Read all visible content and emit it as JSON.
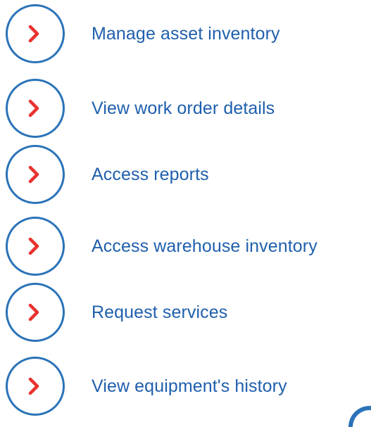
{
  "colors": {
    "circle_border": "#2a73b8",
    "chevron": "#e8322e",
    "label_text": "#1f5fad"
  },
  "icons": {
    "chevron": "chevron-right-icon"
  },
  "items": [
    {
      "label": "Manage asset inventory"
    },
    {
      "label": "View work order details"
    },
    {
      "label": "Access reports"
    },
    {
      "label": "Access warehouse inventory"
    },
    {
      "label": "Request services"
    },
    {
      "label": "View equipment's history"
    }
  ]
}
